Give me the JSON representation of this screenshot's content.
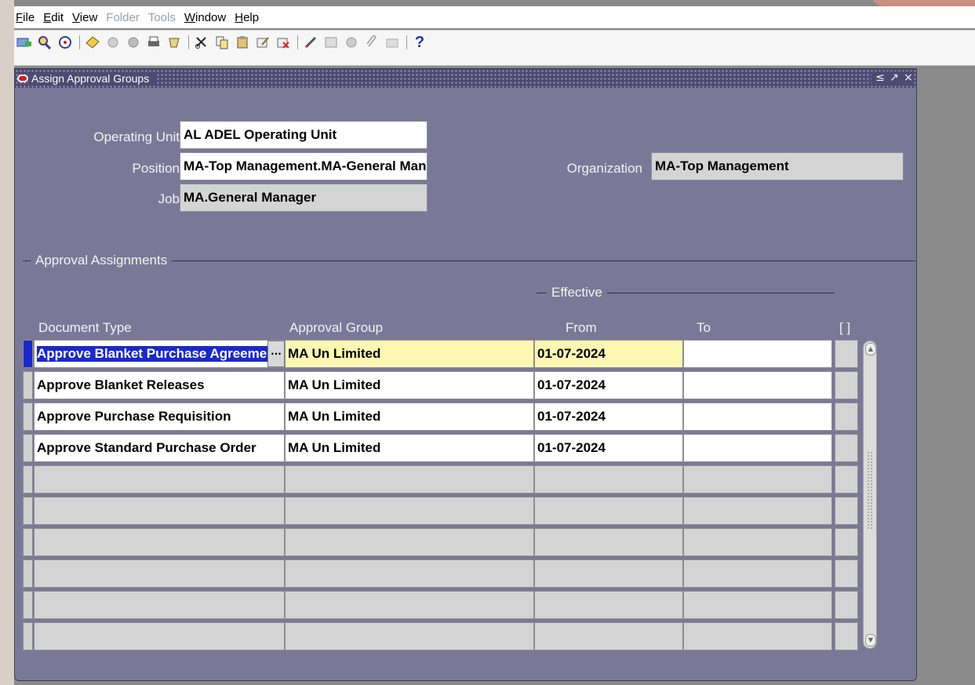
{
  "menu": [
    {
      "key": "F",
      "rest": "ile",
      "enabled": true
    },
    {
      "key": "E",
      "rest": "dit",
      "enabled": true
    },
    {
      "key": "V",
      "rest": "iew",
      "enabled": true
    },
    {
      "key": "",
      "rest": "Folder",
      "enabled": false
    },
    {
      "key": "",
      "rest": "Tools",
      "enabled": false
    },
    {
      "key": "W",
      "rest": "indow",
      "enabled": true
    },
    {
      "key": "H",
      "rest": "elp",
      "enabled": true
    }
  ],
  "toolbar": {
    "help_label": "?"
  },
  "window": {
    "title": "Assign Approval Groups"
  },
  "header": {
    "operating_unit_label": "Operating Unit",
    "operating_unit_value": "AL ADEL Operating Unit",
    "position_label": "Position",
    "position_value": "MA-Top Management.MA-General Manager",
    "organization_label": "Organization",
    "organization_value": "MA-Top Management",
    "job_label": "Job",
    "job_value": "MA.General Manager"
  },
  "assignments": {
    "section_title": "Approval Assignments",
    "effective_label": "Effective",
    "columns": {
      "document_type": "Document Type",
      "approval_group": "Approval Group",
      "from": "From",
      "to": "To",
      "flex": "[ ]"
    },
    "rows": [
      {
        "document_type": "Approve Blanket Purchase Agreement",
        "approval_group": "MA Un Limited",
        "from": "01-07-2024",
        "to": ""
      },
      {
        "document_type": "Approve Blanket Releases",
        "approval_group": "MA Un Limited",
        "from": "01-07-2024",
        "to": ""
      },
      {
        "document_type": "Approve Purchase Requisition",
        "approval_group": "MA Un Limited",
        "from": "01-07-2024",
        "to": ""
      },
      {
        "document_type": "Approve Standard Purchase Order",
        "approval_group": "MA Un Limited",
        "from": "01-07-2024",
        "to": ""
      }
    ],
    "empty_rows": 6
  }
}
